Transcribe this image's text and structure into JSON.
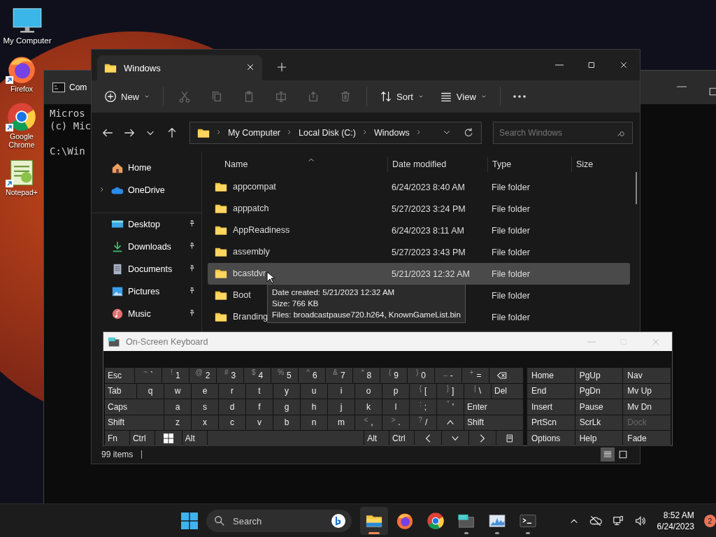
{
  "desktop": {
    "icons": [
      {
        "label": "My Computer",
        "kind": "computer",
        "shortcut": false
      },
      {
        "label": "Firefox",
        "kind": "firefox",
        "shortcut": true
      },
      {
        "label": "Google Chrome",
        "kind": "chrome",
        "shortcut": true
      },
      {
        "label": "Notepad+",
        "kind": "notepad",
        "shortcut": true
      }
    ]
  },
  "console_window": {
    "title": "Com",
    "banner": [
      "Micros",
      "(c) Mic"
    ],
    "prompt": "C:\\Win"
  },
  "explorer": {
    "tab": {
      "title": "Windows"
    },
    "toolbar": {
      "new": "New",
      "actions": [
        {
          "kind": "cut",
          "disabled": true
        },
        {
          "kind": "copy",
          "disabled": true
        },
        {
          "kind": "paste",
          "disabled": true
        },
        {
          "kind": "rename",
          "disabled": true
        },
        {
          "kind": "share",
          "disabled": true
        },
        {
          "kind": "delete",
          "disabled": true
        }
      ],
      "sort": "Sort",
      "view": "View"
    },
    "breadcrumb": [
      "My Computer",
      "Local Disk (C:)",
      "Windows"
    ],
    "search": {
      "placeholder": "Search Windows"
    },
    "nav": [
      {
        "label": "Home",
        "kind": "home",
        "expandable": false,
        "pinned": false,
        "group_start": false
      },
      {
        "label": "OneDrive",
        "kind": "cloud",
        "expandable": true,
        "pinned": false,
        "group_start": false
      },
      {
        "label": "Desktop",
        "kind": "desktop",
        "expandable": false,
        "pinned": true,
        "group_start": true
      },
      {
        "label": "Downloads",
        "kind": "downloads",
        "expandable": false,
        "pinned": true,
        "group_start": false
      },
      {
        "label": "Documents",
        "kind": "documents",
        "expandable": false,
        "pinned": true,
        "group_start": false
      },
      {
        "label": "Pictures",
        "kind": "pictures",
        "expandable": false,
        "pinned": true,
        "group_start": false
      },
      {
        "label": "Music",
        "kind": "music",
        "expandable": false,
        "pinned": true,
        "group_start": false
      }
    ],
    "columns": [
      "Name",
      "Date modified",
      "Type",
      "Size"
    ],
    "rows": [
      {
        "name": "appcompat",
        "date": "6/24/2023 8:40 AM",
        "type": "File folder",
        "selected": false
      },
      {
        "name": "apppatch",
        "date": "5/27/2023 3:24 PM",
        "type": "File folder",
        "selected": false
      },
      {
        "name": "AppReadiness",
        "date": "6/24/2023 8:11 AM",
        "type": "File folder",
        "selected": false
      },
      {
        "name": "assembly",
        "date": "5/27/2023 3:43 PM",
        "type": "File folder",
        "selected": false
      },
      {
        "name": "bcastdvr",
        "date": "5/21/2023 12:32 AM",
        "type": "File folder",
        "selected": true
      },
      {
        "name": "Boot",
        "type": "File folder",
        "selected": false
      },
      {
        "name": "Branding",
        "type": "File folder",
        "selected": false
      }
    ],
    "tooltip": {
      "lines": [
        "Date created: 5/21/2023 12:32 AM",
        "Size: 766 KB",
        "Files: broadcastpause720.h264, KnownGameList.bin"
      ]
    },
    "status": "99 items",
    "views": [
      {
        "kind": "details",
        "selected": true
      },
      {
        "kind": "tiles",
        "selected": false
      }
    ]
  },
  "keyboard": {
    "title": "On-Screen Keyboard",
    "main_rows": [
      [
        {
          "kind": "mod",
          "label": "Esc"
        },
        {
          "kind": "char",
          "shift": "~",
          "label": "`"
        },
        {
          "kind": "char",
          "shift": "!",
          "label": "1"
        },
        {
          "kind": "char",
          "shift": "@",
          "label": "2"
        },
        {
          "kind": "char",
          "shift": "#",
          "label": "3"
        },
        {
          "kind": "char",
          "shift": "$",
          "label": "4"
        },
        {
          "kind": "char",
          "shift": "%",
          "label": "5"
        },
        {
          "kind": "char",
          "shift": "^",
          "label": "6"
        },
        {
          "kind": "char",
          "shift": "&",
          "label": "7"
        },
        {
          "kind": "char",
          "shift": "*",
          "label": "8"
        },
        {
          "kind": "char",
          "shift": "(",
          "label": "9"
        },
        {
          "kind": "char",
          "shift": ")",
          "label": "0"
        },
        {
          "kind": "char",
          "shift": "_",
          "label": "-"
        },
        {
          "kind": "char",
          "shift": "+",
          "label": "="
        },
        {
          "kind": "backspace"
        }
      ],
      [
        {
          "kind": "mod",
          "label": "Tab"
        },
        {
          "kind": "char",
          "label": "q"
        },
        {
          "kind": "char",
          "label": "w"
        },
        {
          "kind": "char",
          "label": "e"
        },
        {
          "kind": "char",
          "label": "r"
        },
        {
          "kind": "char",
          "label": "t"
        },
        {
          "kind": "char",
          "label": "y"
        },
        {
          "kind": "char",
          "label": "u"
        },
        {
          "kind": "char",
          "label": "i"
        },
        {
          "kind": "char",
          "label": "o"
        },
        {
          "kind": "char",
          "label": "p"
        },
        {
          "kind": "char",
          "shift": "{",
          "label": "["
        },
        {
          "kind": "char",
          "shift": "}",
          "label": "]"
        },
        {
          "kind": "char",
          "shift": "|",
          "label": "\\"
        },
        {
          "kind": "mod",
          "label": "Del"
        }
      ],
      [
        {
          "kind": "mod",
          "label": "Caps"
        },
        {
          "kind": "char",
          "label": "a"
        },
        {
          "kind": "char",
          "label": "s"
        },
        {
          "kind": "char",
          "label": "d"
        },
        {
          "kind": "char",
          "label": "f"
        },
        {
          "kind": "char",
          "label": "g"
        },
        {
          "kind": "char",
          "label": "h"
        },
        {
          "kind": "char",
          "label": "j"
        },
        {
          "kind": "char",
          "label": "k"
        },
        {
          "kind": "char",
          "label": "l"
        },
        {
          "kind": "char",
          "shift": ":",
          "label": ";"
        },
        {
          "kind": "char",
          "shift": "\"",
          "label": "'"
        },
        {
          "kind": "mod",
          "label": "Enter"
        }
      ],
      [
        {
          "kind": "mod",
          "label": "Shift"
        },
        {
          "kind": "char",
          "label": "z"
        },
        {
          "kind": "char",
          "label": "x"
        },
        {
          "kind": "char",
          "label": "c"
        },
        {
          "kind": "char",
          "label": "v"
        },
        {
          "kind": "char",
          "label": "b"
        },
        {
          "kind": "char",
          "label": "n"
        },
        {
          "kind": "char",
          "label": "m"
        },
        {
          "kind": "char",
          "shift": "<",
          "label": ","
        },
        {
          "kind": "char",
          "shift": ">",
          "label": "."
        },
        {
          "kind": "char",
          "shift": "?",
          "label": "/"
        },
        {
          "kind": "arrow-up"
        },
        {
          "kind": "mod",
          "label": "Shift"
        }
      ],
      [
        {
          "kind": "mod",
          "label": "Fn"
        },
        {
          "kind": "mod",
          "label": "Ctrl"
        },
        {
          "kind": "windows"
        },
        {
          "kind": "mod",
          "label": "Alt"
        },
        {
          "kind": "space"
        },
        {
          "kind": "mod",
          "label": "Alt"
        },
        {
          "kind": "mod",
          "label": "Ctrl"
        },
        {
          "kind": "arrow-left"
        },
        {
          "kind": "arrow-down"
        },
        {
          "kind": "arrow-right"
        },
        {
          "kind": "menu"
        }
      ]
    ],
    "nav_keys": [
      {
        "label": "Home",
        "disabled": false
      },
      {
        "label": "PgUp",
        "disabled": false
      },
      {
        "label": "Nav",
        "disabled": false
      },
      {
        "label": "End",
        "disabled": false
      },
      {
        "label": "PgDn",
        "disabled": false
      },
      {
        "label": "Mv Up",
        "disabled": false
      },
      {
        "label": "Insert",
        "disabled": false
      },
      {
        "label": "Pause",
        "disabled": false
      },
      {
        "label": "Mv Dn",
        "disabled": false
      },
      {
        "label": "PrtScn",
        "disabled": false
      },
      {
        "label": "ScrLk",
        "disabled": false
      },
      {
        "label": "Dock",
        "disabled": true
      },
      {
        "label": "Options",
        "disabled": false
      },
      {
        "label": "Help",
        "disabled": false
      },
      {
        "label": "Fade",
        "disabled": false
      }
    ]
  },
  "taskbar": {
    "search": "Search",
    "apps": [
      {
        "kind": "explorer",
        "active": true,
        "running": true
      },
      {
        "kind": "firefox",
        "active": false,
        "running": false
      },
      {
        "kind": "chrome",
        "active": false,
        "running": false
      },
      {
        "kind": "keyboard",
        "active": false,
        "running": true
      },
      {
        "kind": "monitor",
        "active": false,
        "running": true
      },
      {
        "kind": "terminal",
        "active": false,
        "running": true
      }
    ],
    "time": "8:52 AM",
    "date": "6/24/2023",
    "notifications": "2"
  }
}
